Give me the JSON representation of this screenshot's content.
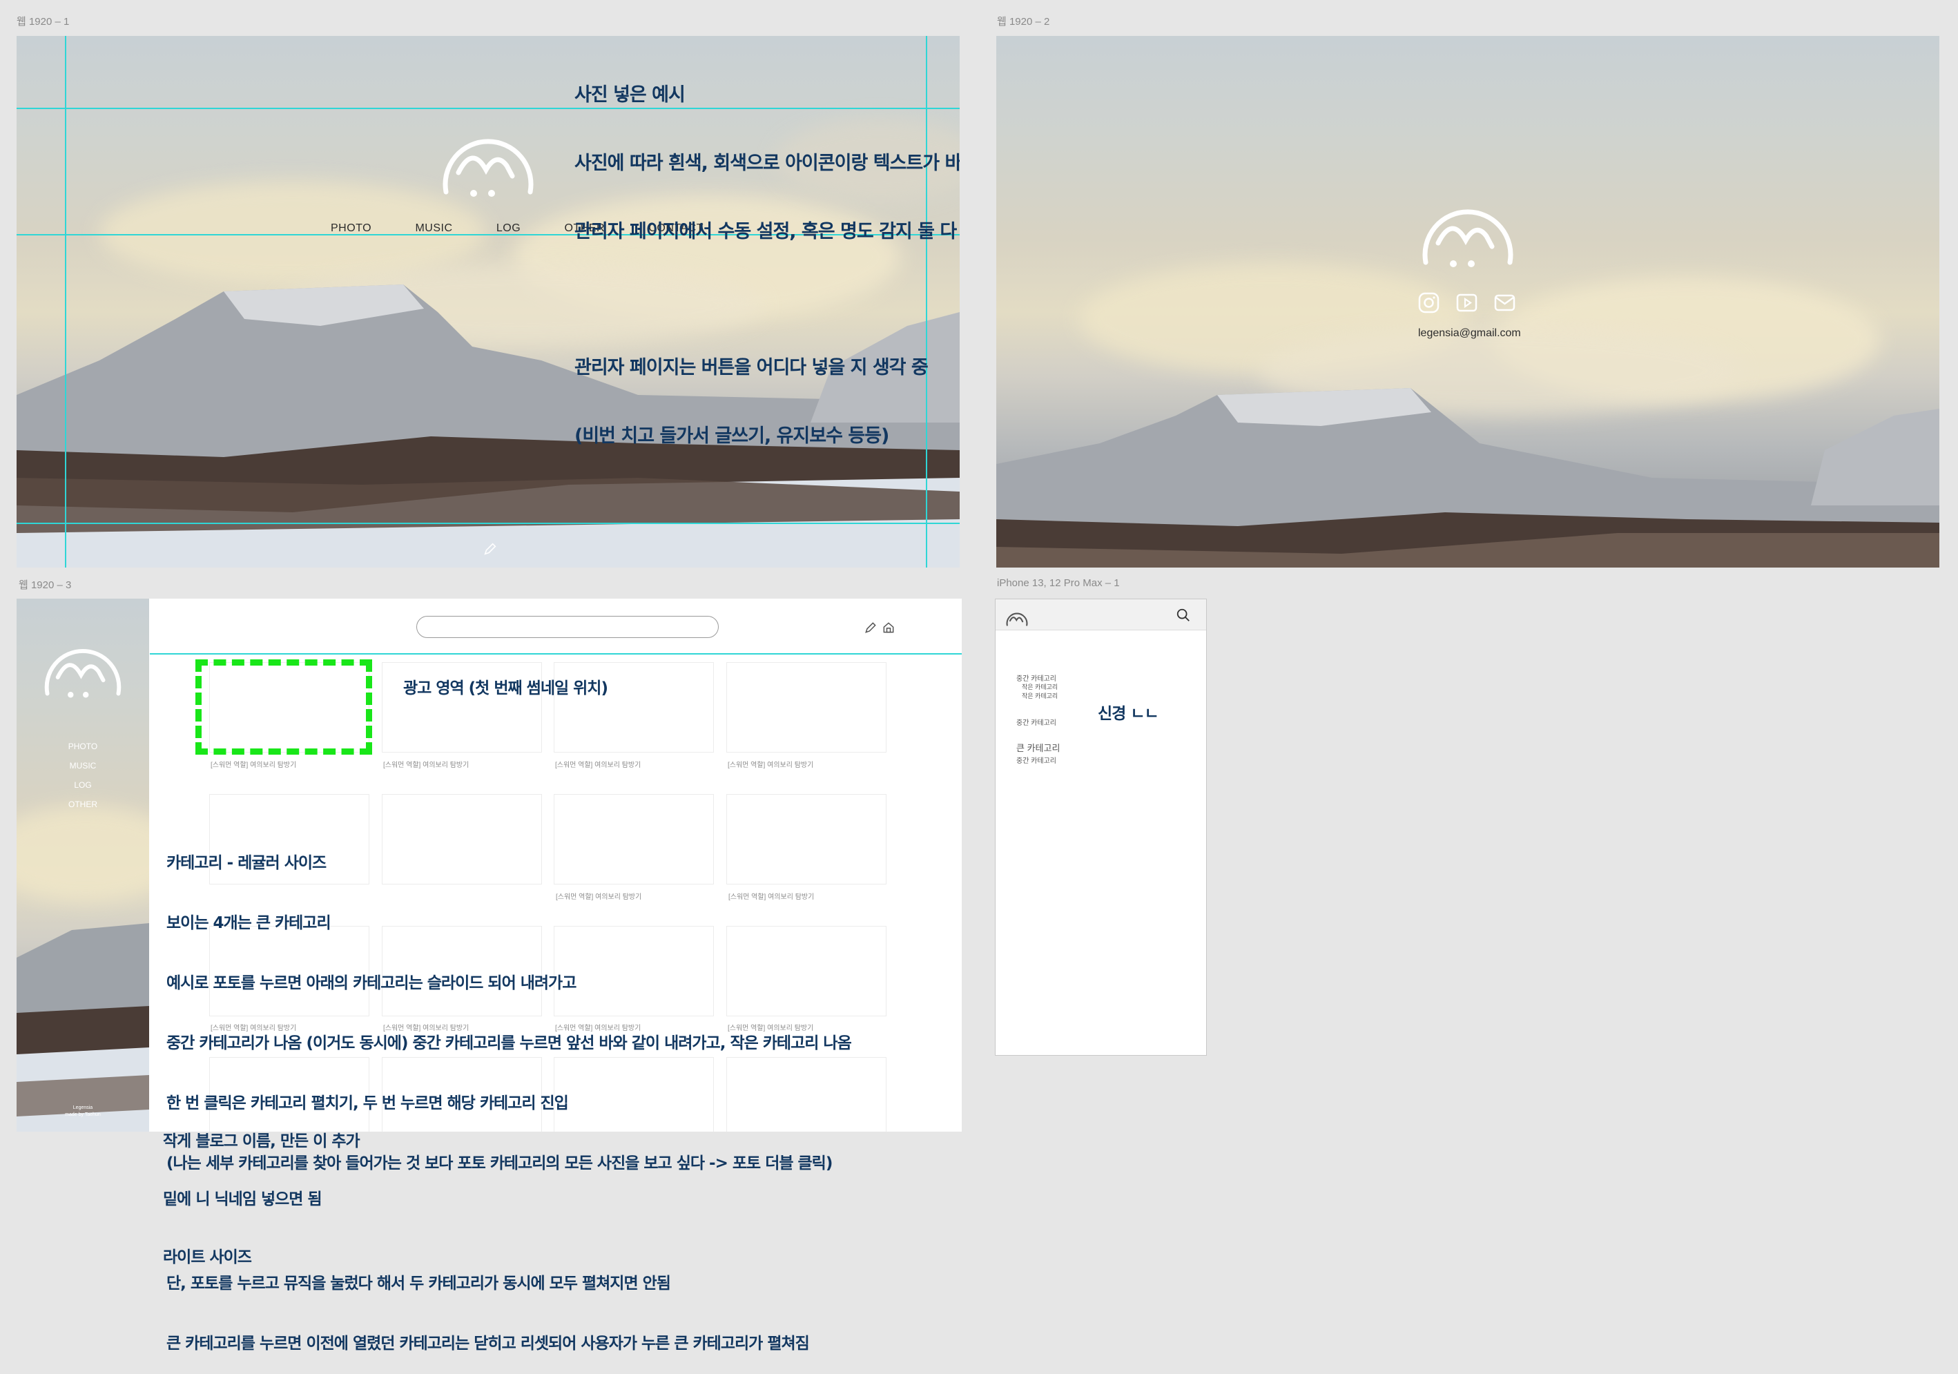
{
  "frames": {
    "f1": "웹 1920 – 1",
    "f2": "웹 1920 – 2",
    "f3": "웹 1920 – 3",
    "f4": "iPhone 13, 12 Pro Max – 1"
  },
  "nav": [
    "PHOTO",
    "MUSIC",
    "LOG",
    "OTHER",
    "CONTACT"
  ],
  "side_nav": [
    "PHOTO",
    "MUSIC",
    "LOG",
    "OTHER"
  ],
  "notes": {
    "photo_lines": [
      "사진 넣은 예시",
      "사진에 따라 흰색, 회색으로 아이콘이랑 텍스트가 바뀌어야 하는데",
      "관리자 페이지에서 수동 설정, 혹은 명도 감지 둘 다 상관 없음",
      "",
      "관리자 페이지는 버튼을 어디다 넣을 지 생각 중",
      "(비번 치고 들가서 글쓰기, 유지보수 등등)"
    ],
    "ad": "광고 영역 (첫 번째 썸네일 위치)",
    "category_lines": [
      "카테고리 - 레귤러 사이즈",
      "보이는 4개는 큰 카테고리",
      "예시로 포토를 누르면 아래의 카테고리는 슬라이드 되어 내려가고",
      "중간 카테고리가 나옴 (이거도 동시에) 중간 카테고리를 누르면 앞선 바와 같이 내려가고, 작은 카테고리 나옴",
      "한 번 클릭은 카테고리 펼치기, 두 번 누르면 해당 카테고리 진입",
      "(나는 세부 카테고리를 찾아 들어가는 것 보다 포토 카테고리의 모든 사진을 보고 싶다 -> 포토 더블 클릭)",
      "",
      "단, 포토를 누르고 뮤직을 눌렀다 해서 두 카테고리가 동시에 모두 펼쳐지면 안됨",
      "큰 카테고리를 누르면 이전에 열렸던 카테고리는 닫히고 리셋되어 사용자가 누른 큰 카테고리가 펼쳐짐"
    ],
    "blog_lines": [
      "작게 블로그 이름, 만든 이 추가",
      "밑에 니 닉네임 넣으면 됨",
      "라이트 사이즈"
    ],
    "phone": "신경 ㄴㄴ"
  },
  "email": "legensia@gmail.com",
  "thumb_caption": "[스워먼 역할] 여의보리 탐방기",
  "sidebar_footer": [
    "Legensia",
    "made by Taehun"
  ],
  "phone_menu": [
    {
      "label": "중간 카테고리",
      "level": "mid"
    },
    {
      "label": "작은 카테고리",
      "level": "small"
    },
    {
      "label": "작은 카테고리",
      "level": "small"
    },
    {
      "label": "중간 카테고리",
      "level": "mid"
    },
    {
      "label": "큰 카테고리",
      "level": "big"
    },
    {
      "label": "중간 카테고리",
      "level": "mid"
    }
  ],
  "colors": {
    "annotation": "#123760",
    "guide": "#2fd6d6",
    "ad_dash": "#19e619"
  },
  "icons": [
    "logo-arc-icon",
    "instagram-icon",
    "youtube-icon",
    "mail-icon",
    "edit-icon",
    "home-icon",
    "search-icon"
  ]
}
